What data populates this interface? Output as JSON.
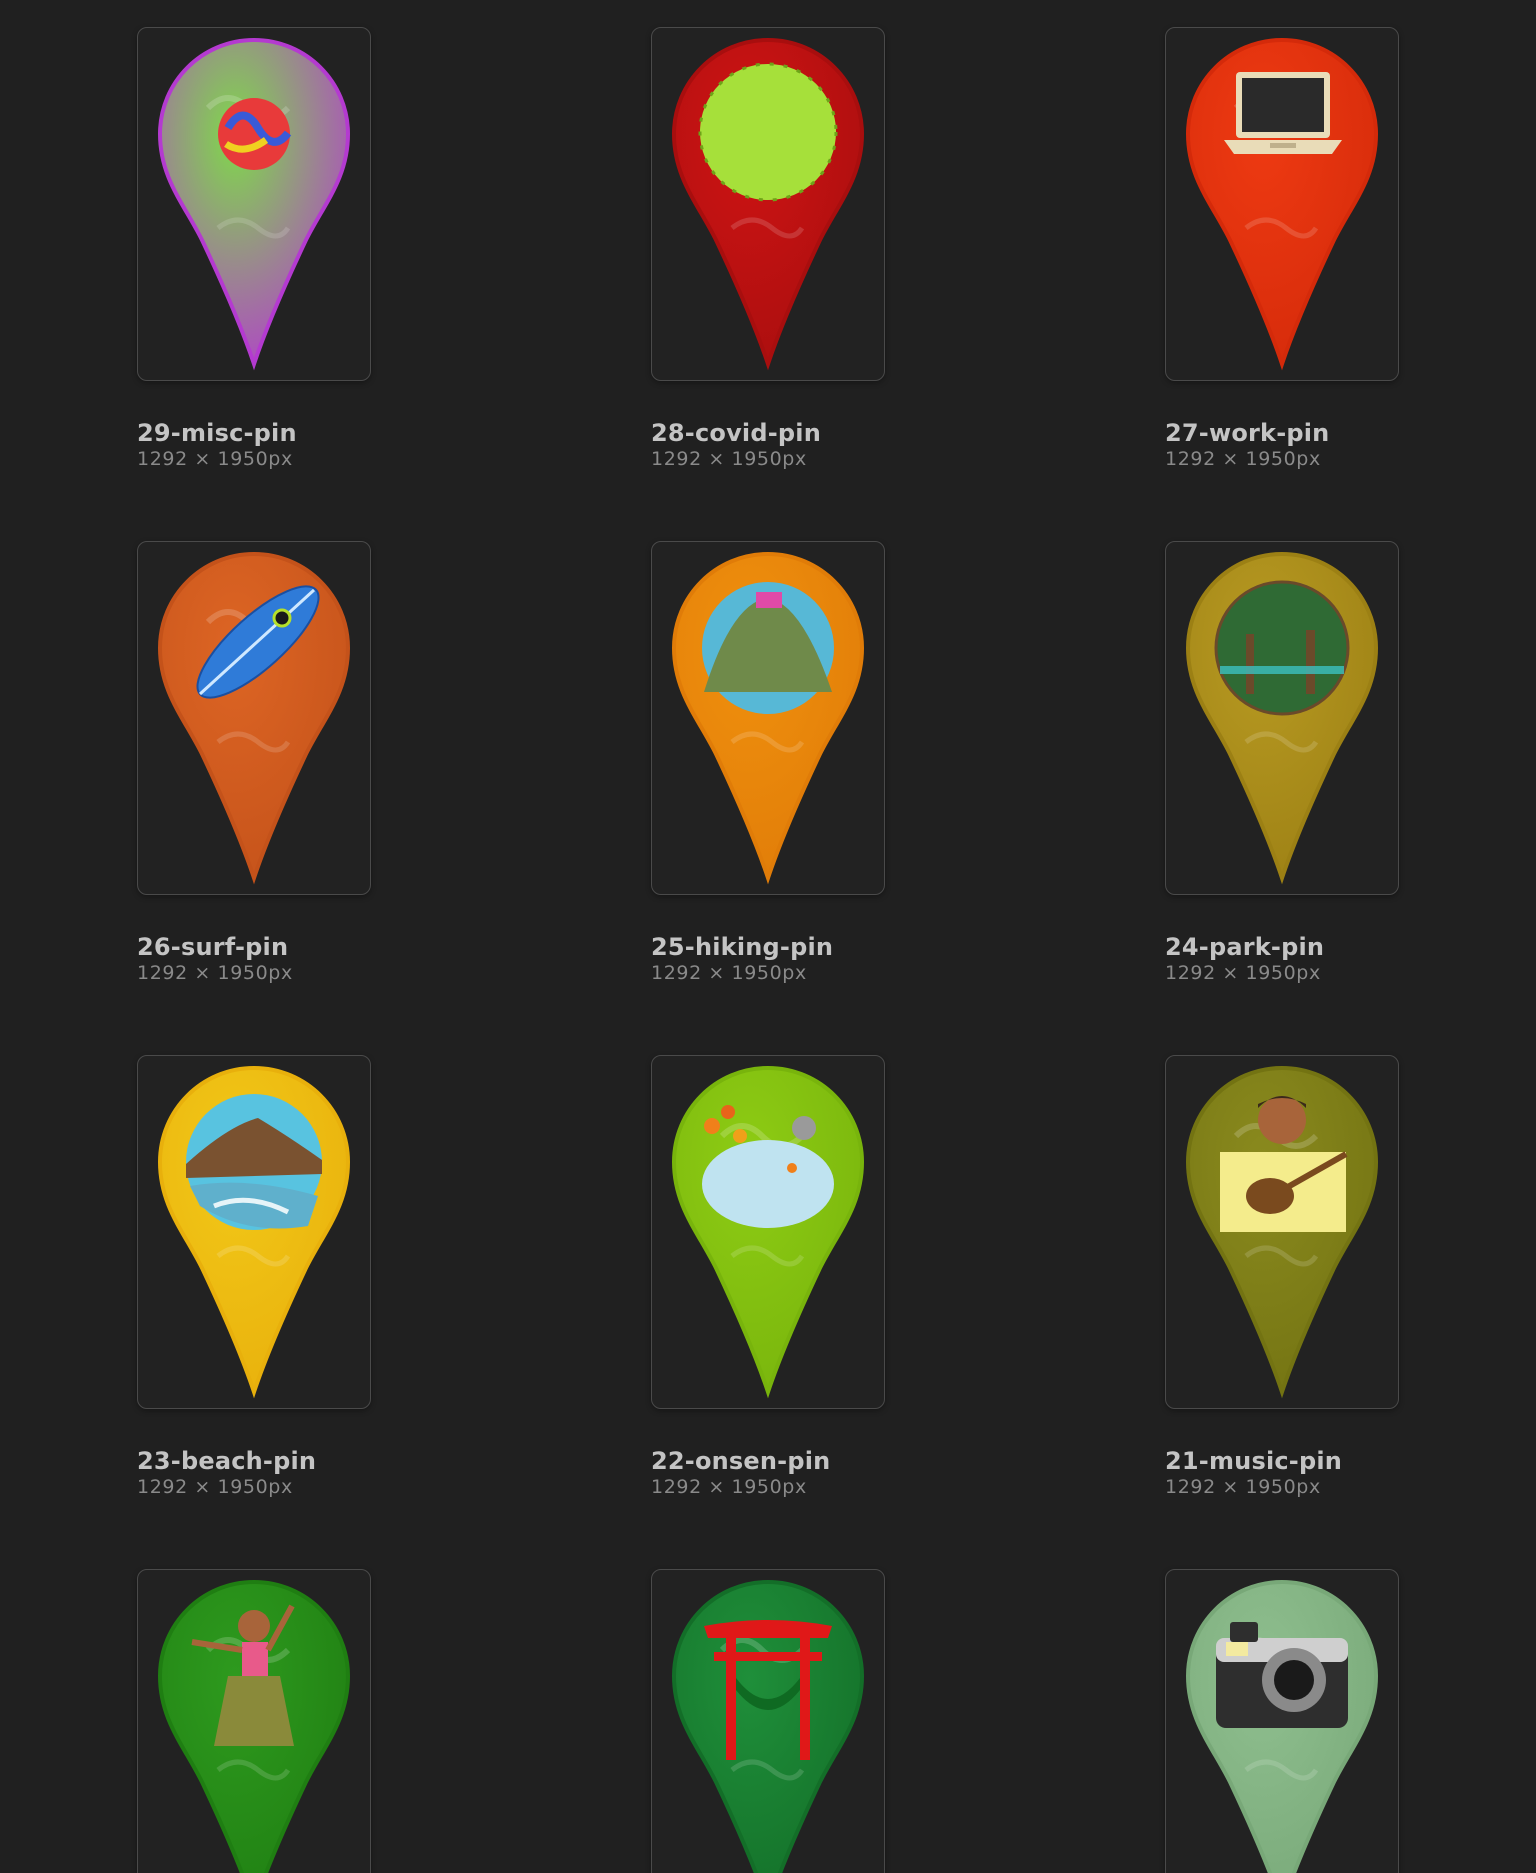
{
  "items": [
    {
      "name": "29-misc-pin",
      "dims": "1292 × 1950px",
      "icon": "rainbow-swirl-icon",
      "color": "#7fd94a",
      "rim": "#b43ad0",
      "inner": "#f0d020"
    },
    {
      "name": "28-covid-pin",
      "dims": "1292 × 1950px",
      "icon": "virus-icon",
      "color": "#cf1414",
      "rim": "#a80e0e",
      "inner": "#a6e03a"
    },
    {
      "name": "27-work-pin",
      "dims": "1292 × 1950px",
      "icon": "laptop-icon",
      "color": "#ee3a12",
      "rim": "#d42a0a",
      "inner": "#2a2a2a"
    },
    {
      "name": "26-surf-pin",
      "dims": "1292 × 1950px",
      "icon": "surfboard-icon",
      "color": "#dd6524",
      "rim": "#c4521a",
      "inner": "#2f7bd8"
    },
    {
      "name": "25-hiking-pin",
      "dims": "1292 × 1950px",
      "icon": "mountain-icon",
      "color": "#f0900e",
      "rim": "#e07c08",
      "inner": "#6f8a4a"
    },
    {
      "name": "24-park-pin",
      "dims": "1292 × 1950px",
      "icon": "trees-icon",
      "color": "#b89a22",
      "rim": "#9c8014",
      "inner": "#4c6f2e"
    },
    {
      "name": "23-beach-pin",
      "dims": "1292 × 1950px",
      "icon": "beach-icon",
      "color": "#f2c818",
      "rim": "#e8b00c",
      "inner": "#58c3e0"
    },
    {
      "name": "22-onsen-pin",
      "dims": "1292 × 1950px",
      "icon": "hot-spring-icon",
      "color": "#8ecc14",
      "rim": "#78b40c",
      "inner": "#bfe3f0"
    },
    {
      "name": "21-music-pin",
      "dims": "1292 × 1950px",
      "icon": "ukulele-player-icon",
      "color": "#8a8a1e",
      "rim": "#737312",
      "inner": "#f4ec8c"
    },
    {
      "name": "",
      "dims": "",
      "icon": "hula-dancer-icon",
      "color": "#2e9a1e",
      "rim": "#1f7e12",
      "inner": "#8a8a3a"
    },
    {
      "name": "",
      "dims": "",
      "icon": "torii-gate-icon",
      "color": "#1f8f3a",
      "rim": "#136e28",
      "inner": "#e01818"
    },
    {
      "name": "",
      "dims": "",
      "icon": "camera-icon",
      "color": "#8fbf8f",
      "rim": "#78a878",
      "inner": "#3a3a3a"
    }
  ]
}
